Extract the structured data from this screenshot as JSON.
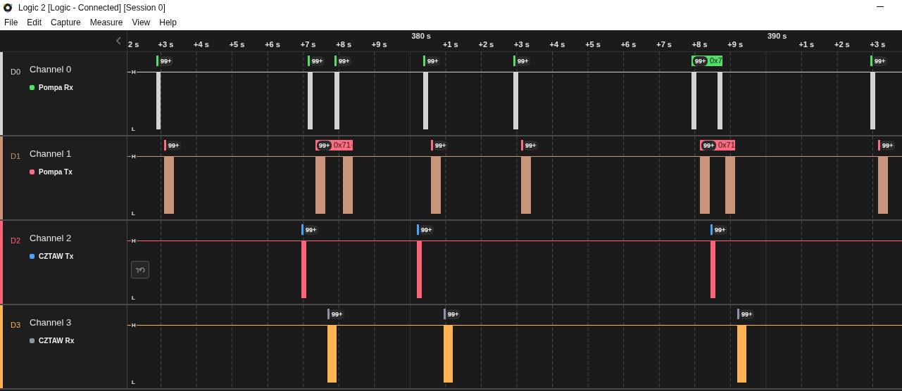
{
  "window": {
    "title": "Logic 2 [Logic - Connected] [Session 0]"
  },
  "menu": [
    "File",
    "Edit",
    "Capture",
    "Measure",
    "View",
    "Help"
  ],
  "ruler": {
    "ticks": [
      {
        "label": "2 s"
      },
      {
        "label": "+3 s"
      },
      {
        "label": "+4 s"
      },
      {
        "label": "+5 s"
      },
      {
        "label": "+6 s"
      },
      {
        "label": "+7 s"
      },
      {
        "label": "+8 s"
      },
      {
        "label": "+9 s"
      },
      {
        "major": "380 s"
      },
      {
        "label": "+1 s"
      },
      {
        "label": "+2 s"
      },
      {
        "label": "+3 s"
      },
      {
        "label": "+4 s"
      },
      {
        "label": "+5 s"
      },
      {
        "label": "+6 s"
      },
      {
        "label": "+7 s"
      },
      {
        "label": "+8 s"
      },
      {
        "label": "+9 s"
      },
      {
        "major": "390 s"
      },
      {
        "label": "+1 s"
      },
      {
        "label": "+2 s"
      },
      {
        "label": "+3 s"
      }
    ]
  },
  "channels": [
    {
      "id": "D0",
      "name": "Channel 0",
      "color": "#d4d4d4",
      "high_label": "H",
      "low_label": "L",
      "analyzer": {
        "name": "Pompa Rx",
        "color": "#4ee267"
      },
      "markers": [
        {
          "count": "99+"
        },
        {
          "count": "99+"
        },
        {
          "count": "99+"
        },
        {
          "count": "99+"
        },
        {
          "count": "99+"
        },
        {
          "count": "99+",
          "value": "0x7"
        },
        {
          "count": "99+"
        }
      ]
    },
    {
      "id": "D1",
      "name": "Channel 1",
      "color": "#c8957a",
      "high_label": "H",
      "low_label": "L",
      "analyzer": {
        "name": "Pompa Tx",
        "color": "#ff6b7f"
      },
      "markers": [
        {
          "count": "99+"
        },
        {
          "count": "99+",
          "value": "0x71·"
        },
        {
          "count": "99+"
        },
        {
          "count": "99+"
        },
        {
          "count": "99+",
          "value": "0x71"
        },
        {
          "count": "99+"
        }
      ]
    },
    {
      "id": "D2",
      "name": "Channel 2",
      "color": "#ff6377",
      "high_label": "H",
      "low_label": "L",
      "filter_button": true,
      "analyzer": {
        "name": "CZTAW Tx",
        "color": "#4aa3ff"
      },
      "markers": [
        {
          "count": "99+"
        },
        {
          "count": "99+"
        },
        {
          "count": "99+"
        }
      ]
    },
    {
      "id": "D3",
      "name": "Channel 3",
      "color": "#ffb454",
      "high_label": "H",
      "low_label": "L",
      "analyzer": {
        "name": "CZTAW Rx",
        "color": "#8c95a6"
      },
      "markers": [
        {
          "count": "99+"
        },
        {
          "count": "99+"
        },
        {
          "count": "99+"
        }
      ]
    }
  ]
}
